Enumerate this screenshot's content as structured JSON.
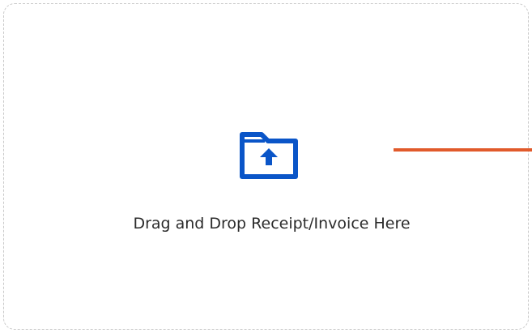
{
  "dropzone": {
    "text": "Drag and Drop Receipt/Invoice Here",
    "icon": "folder-upload-icon"
  },
  "colors": {
    "icon": "#0a55c8",
    "accent_line": "#e15a2b",
    "border": "#c9c9c9",
    "text": "#2b2b2b"
  }
}
